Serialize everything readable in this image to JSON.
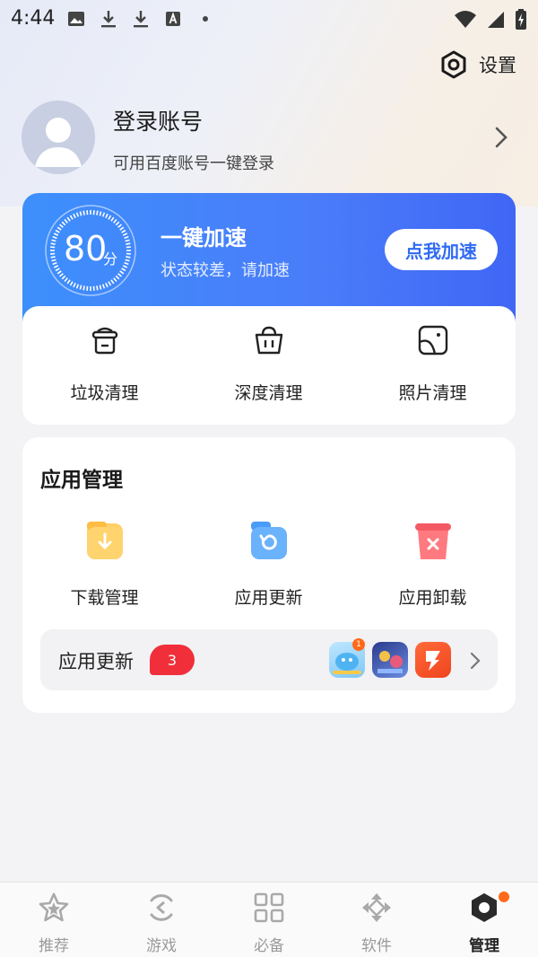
{
  "status_bar": {
    "time": "4:44",
    "icons_left": [
      "image-icon",
      "download-icon",
      "download-icon",
      "a-box-icon",
      "dot-icon"
    ],
    "icons_right": [
      "wifi-icon",
      "signal-icon",
      "battery-charging-icon"
    ]
  },
  "header": {
    "settings_label": "设置"
  },
  "profile": {
    "title": "登录账号",
    "subtitle": "可用百度账号一键登录"
  },
  "speed": {
    "score": "80",
    "score_unit": "分",
    "title": "一键加速",
    "subtitle": "状态较差，请加速",
    "button_label": "点我加速"
  },
  "clean": {
    "items": [
      {
        "label": "垃圾清理",
        "icon": "trash-can-icon"
      },
      {
        "label": "深度清理",
        "icon": "basket-icon"
      },
      {
        "label": "照片清理",
        "icon": "photo-icon"
      }
    ]
  },
  "app_management": {
    "title": "应用管理",
    "items": [
      {
        "label": "下载管理",
        "icon": "download-folder-icon"
      },
      {
        "label": "应用更新",
        "icon": "update-box-icon"
      },
      {
        "label": "应用卸载",
        "icon": "uninstall-bin-icon"
      }
    ],
    "update_row": {
      "label": "应用更新",
      "badge": "3",
      "mini_badge": "1"
    }
  },
  "bottom_nav": {
    "items": [
      {
        "label": "推荐",
        "icon": "star-icon"
      },
      {
        "label": "游戏",
        "icon": "game-icon"
      },
      {
        "label": "必备",
        "icon": "grid-icon"
      },
      {
        "label": "软件",
        "icon": "diamond-arrows-icon"
      },
      {
        "label": "管理",
        "icon": "manage-icon"
      }
    ],
    "active_index": 4
  },
  "colors": {
    "accent_blue": "#3f7bf8",
    "badge_red": "#f02f3a",
    "orange": "#ff6a1a"
  }
}
